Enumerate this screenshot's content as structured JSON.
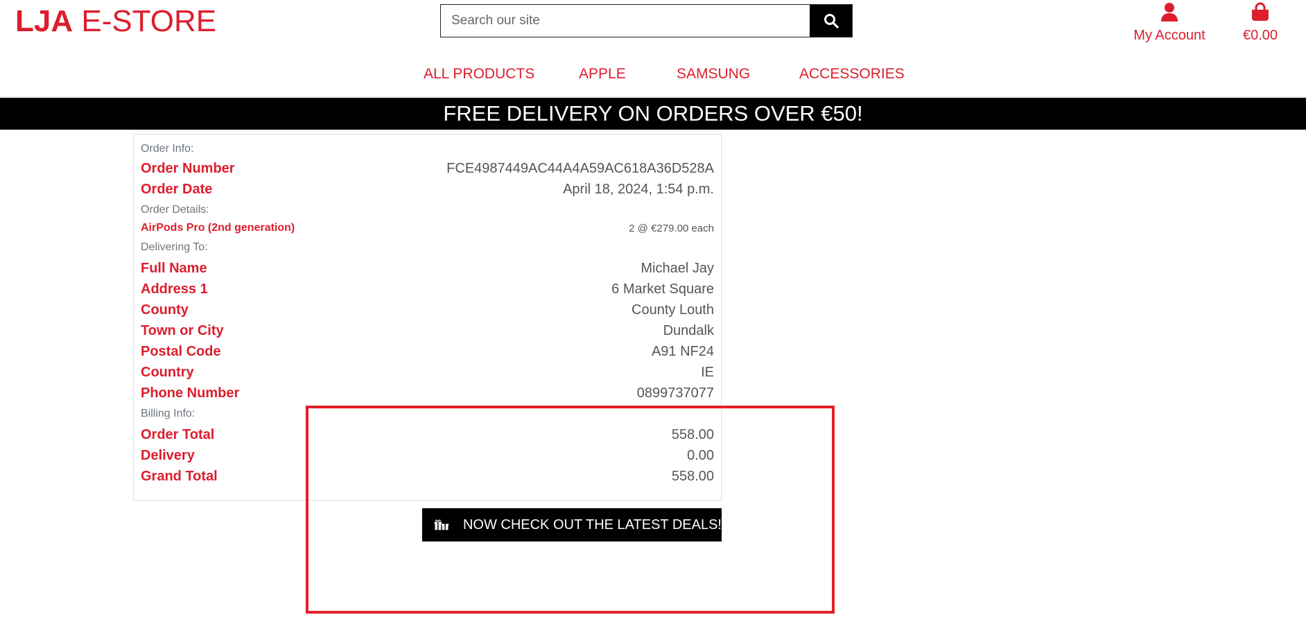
{
  "header": {
    "logo_bold": "LJA",
    "logo_rest": "E-STORE",
    "search_placeholder": "Search our site",
    "account_label": "My Account",
    "cart_total": "€0.00"
  },
  "nav": {
    "items": [
      "ALL PRODUCTS",
      "APPLE",
      "SAMSUNG",
      "ACCESSORIES"
    ]
  },
  "banner": "FREE DELIVERY ON ORDERS OVER €50!",
  "order": {
    "order_info_heading": "Order Info:",
    "order_number_label": "Order Number",
    "order_number": "FCE4987449AC44A4A59AC618A36D528A",
    "order_date_label": "Order Date",
    "order_date": "April 18, 2024, 1:54 p.m.",
    "order_details_heading": "Order Details:",
    "item_name": "AirPods Pro (2nd generation)",
    "item_qty_price": "2 @ €279.00 each",
    "delivering_heading": "Delivering To:",
    "full_name_label": "Full Name",
    "full_name": "Michael Jay",
    "address1_label": "Address 1",
    "address1": "6 Market Square",
    "county_label": "County",
    "county": "County Louth",
    "town_label": "Town or City",
    "town": "Dundalk",
    "postal_label": "Postal Code",
    "postal": "A91 NF24",
    "country_label": "Country",
    "country": "IE",
    "phone_label": "Phone Number",
    "phone": "0899737077",
    "billing_heading": "Billing Info:",
    "order_total_label": "Order Total",
    "order_total": "558.00",
    "delivery_label": "Delivery",
    "delivery": "0.00",
    "grand_total_label": "Grand Total",
    "grand_total": "558.00"
  },
  "deals_button": "NOW CHECK OUT THE LATEST DEALS!",
  "colors": {
    "brand_red": "#dc1e2d",
    "highlight_red": "#e3212b",
    "banner_bg": "#000000"
  }
}
